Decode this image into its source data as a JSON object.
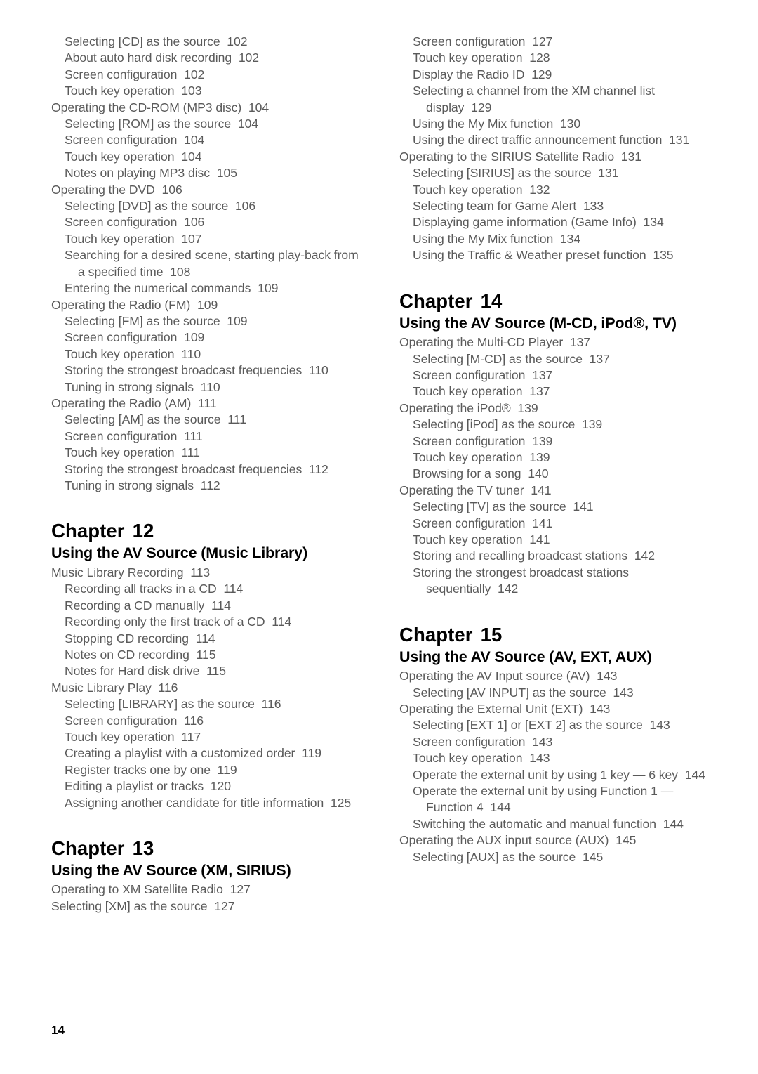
{
  "page": {
    "folio": "14"
  },
  "left_column": {
    "entries_top": [
      {
        "level": 2,
        "text": "Selecting [CD] as the source",
        "page": "102"
      },
      {
        "level": 2,
        "text": "About auto hard disk recording",
        "page": "102"
      },
      {
        "level": 2,
        "text": "Screen configuration",
        "page": "102"
      },
      {
        "level": 2,
        "text": "Touch key operation",
        "page": "103"
      },
      {
        "level": 1,
        "text": "Operating the CD-ROM (MP3 disc)",
        "page": "104"
      },
      {
        "level": 2,
        "text": "Selecting [ROM] as the source",
        "page": "104"
      },
      {
        "level": 2,
        "text": "Screen configuration",
        "page": "104"
      },
      {
        "level": 2,
        "text": "Touch key operation",
        "page": "104"
      },
      {
        "level": 2,
        "text": "Notes on playing MP3 disc",
        "page": "105"
      },
      {
        "level": 1,
        "text": "Operating the DVD",
        "page": "106"
      },
      {
        "level": 2,
        "text": "Selecting [DVD] as the source",
        "page": "106"
      },
      {
        "level": 2,
        "text": "Screen configuration",
        "page": "106"
      },
      {
        "level": 2,
        "text": "Touch key operation",
        "page": "107"
      },
      {
        "level": 2,
        "text": "Searching for a desired scene, starting play-back from a specified time",
        "page": "108",
        "wrap": true
      },
      {
        "level": 2,
        "text": "Entering the numerical commands",
        "page": "109"
      },
      {
        "level": 1,
        "text": "Operating the Radio (FM)",
        "page": "109"
      },
      {
        "level": 2,
        "text": "Selecting [FM] as the source",
        "page": "109"
      },
      {
        "level": 2,
        "text": "Screen configuration",
        "page": "109"
      },
      {
        "level": 2,
        "text": "Touch key operation",
        "page": "110"
      },
      {
        "level": 2,
        "text": "Storing the strongest broadcast frequencies",
        "page": "110",
        "wrap": true
      },
      {
        "level": 2,
        "text": "Tuning in strong signals",
        "page": "110"
      },
      {
        "level": 1,
        "text": "Operating the Radio (AM)",
        "page": "111"
      },
      {
        "level": 2,
        "text": "Selecting [AM] as the source",
        "page": "111"
      },
      {
        "level": 2,
        "text": "Screen configuration",
        "page": "111"
      },
      {
        "level": 2,
        "text": "Touch key operation",
        "page": "111"
      },
      {
        "level": 2,
        "text": "Storing the strongest broadcast frequencies",
        "page": "112",
        "wrap": true
      },
      {
        "level": 2,
        "text": "Tuning in strong signals",
        "page": "112"
      }
    ],
    "chapter_12": {
      "number_label": "Chapter",
      "number": "12",
      "title": "Using the AV Source (Music Library)",
      "entries": [
        {
          "level": 1,
          "text": "Music Library Recording",
          "page": "113"
        },
        {
          "level": 2,
          "text": "Recording all tracks in a CD",
          "page": "114"
        },
        {
          "level": 2,
          "text": "Recording a CD manually",
          "page": "114"
        },
        {
          "level": 2,
          "text": "Recording only the first track of a CD",
          "page": "114"
        },
        {
          "level": 2,
          "text": "Stopping CD recording",
          "page": "114"
        },
        {
          "level": 2,
          "text": "Notes on CD recording",
          "page": "115"
        },
        {
          "level": 2,
          "text": "Notes for Hard disk drive",
          "page": "115"
        },
        {
          "level": 1,
          "text": "Music Library Play",
          "page": "116"
        },
        {
          "level": 2,
          "text": "Selecting [LIBRARY] as the source",
          "page": "116"
        },
        {
          "level": 2,
          "text": "Screen configuration",
          "page": "116"
        },
        {
          "level": 2,
          "text": "Touch key operation",
          "page": "117"
        },
        {
          "level": 2,
          "text": "Creating a playlist with a customized order",
          "page": "119"
        },
        {
          "level": 2,
          "text": "Register tracks one by one",
          "page": "119"
        },
        {
          "level": 2,
          "text": "Editing a playlist or tracks",
          "page": "120"
        },
        {
          "level": 2,
          "text": "Assigning another candidate for title information",
          "page": "125",
          "wrap": true
        }
      ]
    },
    "chapter_13": {
      "number_label": "Chapter",
      "number": "13",
      "title": "Using the AV Source (XM, SIRIUS)",
      "entries": [
        {
          "level": 1,
          "text": "Operating to XM Satellite Radio",
          "page": "127"
        },
        {
          "level": 1,
          "text": "Selecting [XM] as the source",
          "page": "127"
        }
      ]
    }
  },
  "right_column": {
    "entries_top": [
      {
        "level": 2,
        "text": "Screen configuration",
        "page": "127"
      },
      {
        "level": 2,
        "text": "Touch key operation",
        "page": "128"
      },
      {
        "level": 2,
        "text": "Display the Radio ID",
        "page": "129"
      },
      {
        "level": 2,
        "text": "Selecting a channel from the XM channel list display",
        "page": "129",
        "wrap": true
      },
      {
        "level": 2,
        "text": "Using the My Mix function",
        "page": "130"
      },
      {
        "level": 2,
        "text": "Using the direct traffic announcement function",
        "page": "131",
        "wrap": true
      },
      {
        "level": 1,
        "text": "Operating to the SIRIUS Satellite Radio",
        "page": "131"
      },
      {
        "level": 2,
        "text": "Selecting [SIRIUS] as the source",
        "page": "131"
      },
      {
        "level": 2,
        "text": "Touch key operation",
        "page": "132"
      },
      {
        "level": 2,
        "text": "Selecting team for Game Alert",
        "page": "133"
      },
      {
        "level": 2,
        "text": "Displaying game information (Game Info)",
        "page": "134"
      },
      {
        "level": 2,
        "text": "Using the My Mix function",
        "page": "134"
      },
      {
        "level": 2,
        "text": "Using the Traffic & Weather preset function",
        "page": "135"
      }
    ],
    "chapter_14": {
      "number_label": "Chapter",
      "number": "14",
      "title": "Using the AV Source (M-CD, iPod®, TV)",
      "entries": [
        {
          "level": 1,
          "text": "Operating the Multi-CD Player",
          "page": "137"
        },
        {
          "level": 2,
          "text": "Selecting [M-CD] as the source",
          "page": "137"
        },
        {
          "level": 2,
          "text": "Screen configuration",
          "page": "137"
        },
        {
          "level": 2,
          "text": "Touch key operation",
          "page": "137"
        },
        {
          "level": 1,
          "text": "Operating the iPod®",
          "page": "139"
        },
        {
          "level": 2,
          "text": "Selecting [iPod] as the source",
          "page": "139"
        },
        {
          "level": 2,
          "text": "Screen configuration",
          "page": "139"
        },
        {
          "level": 2,
          "text": "Touch key operation",
          "page": "139"
        },
        {
          "level": 2,
          "text": "Browsing for a song",
          "page": "140"
        },
        {
          "level": 1,
          "text": "Operating the TV tuner",
          "page": "141"
        },
        {
          "level": 2,
          "text": "Selecting [TV] as the source",
          "page": "141"
        },
        {
          "level": 2,
          "text": "Screen configuration",
          "page": "141"
        },
        {
          "level": 2,
          "text": "Touch key operation",
          "page": "141"
        },
        {
          "level": 2,
          "text": "Storing and recalling broadcast stations",
          "page": "142"
        },
        {
          "level": 2,
          "text": "Storing the strongest broadcast stations sequentially",
          "page": "142",
          "wrap": true
        }
      ]
    },
    "chapter_15": {
      "number_label": "Chapter",
      "number": "15",
      "title": "Using the AV Source (AV, EXT, AUX)",
      "entries": [
        {
          "level": 1,
          "text": "Operating the AV Input source (AV)",
          "page": "143"
        },
        {
          "level": 2,
          "text": "Selecting [AV INPUT] as the source",
          "page": "143"
        },
        {
          "level": 1,
          "text": "Operating the External Unit (EXT)",
          "page": "143"
        },
        {
          "level": 2,
          "text": "Selecting [EXT 1] or [EXT 2] as the source",
          "page": "143"
        },
        {
          "level": 2,
          "text": "Screen configuration",
          "page": "143"
        },
        {
          "level": 2,
          "text": "Touch key operation",
          "page": "143"
        },
        {
          "level": 2,
          "text": "Operate the external unit by using 1 key — 6 key",
          "page": "144",
          "wrap": true
        },
        {
          "level": 2,
          "text": "Operate the external unit by using Function 1 — Function 4",
          "page": "144",
          "wrap": true
        },
        {
          "level": 2,
          "text": "Switching the automatic and manual function",
          "page": "144",
          "wrap": true
        },
        {
          "level": 1,
          "text": "Operating the AUX input source (AUX)",
          "page": "145"
        },
        {
          "level": 2,
          "text": "Selecting [AUX] as the source",
          "page": "145"
        }
      ]
    }
  }
}
